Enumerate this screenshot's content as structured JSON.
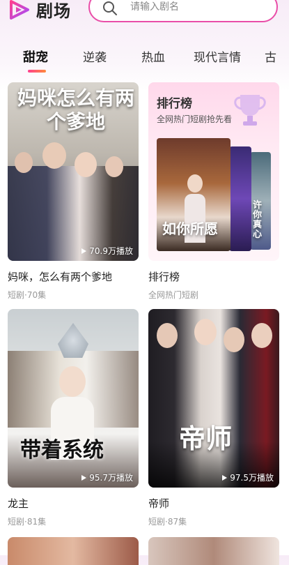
{
  "header": {
    "title": "剧场",
    "search_placeholder": "请输入剧名"
  },
  "tabs": [
    {
      "label": "甜宠",
      "active": true
    },
    {
      "label": "逆袭",
      "active": false
    },
    {
      "label": "热血",
      "active": false
    },
    {
      "label": "现代言情",
      "active": false
    },
    {
      "label": "古",
      "active": false
    }
  ],
  "cards": [
    {
      "title": "妈咪，怎么有两个爹地",
      "sub": "短剧·70集",
      "plays": "70.9万播放",
      "poster_text": "妈咪怎么有两个爹地"
    },
    {
      "title": "排行榜",
      "sub": "全网热门短剧",
      "rank_heading": "排行榜",
      "rank_tagline": "全网热门短剧抢先看",
      "poster_text": "如你所愿",
      "poster_text_2": "许你真心"
    },
    {
      "title": "龙主",
      "sub": "短剧·81集",
      "plays": "95.7万播放",
      "poster_text": "带着系统"
    },
    {
      "title": "帝师",
      "sub": "短剧·87集",
      "plays": "97.5万播放",
      "poster_text": "帝师"
    }
  ],
  "colors": {
    "accent": "#e94ea8",
    "tab_indicator_start": "#ff3f8e",
    "tab_indicator_end": "#ff8a3c"
  }
}
